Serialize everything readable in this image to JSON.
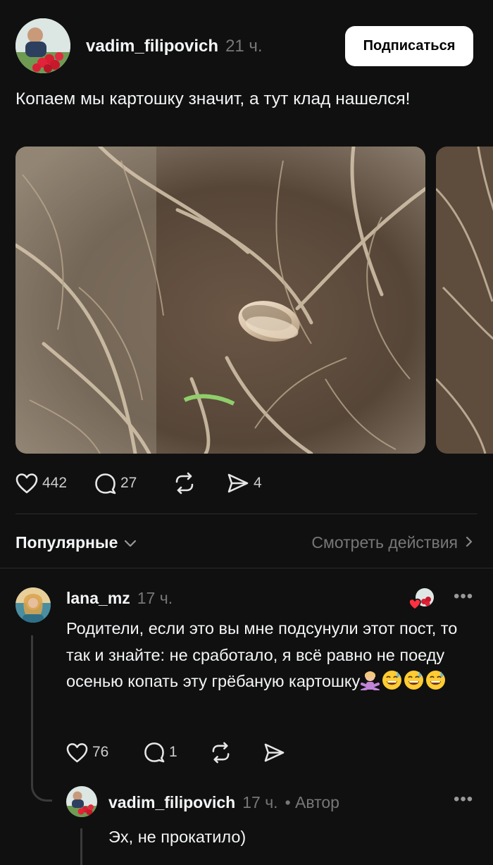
{
  "post": {
    "author": "vadim_filipovich",
    "time": "21 ч.",
    "follow_label": "Подписаться",
    "text": "Копаем мы картошку значит, а тут клад нашелся!",
    "stats": {
      "likes": "442",
      "comments": "27",
      "shares": "4"
    }
  },
  "sort": {
    "label": "Популярные",
    "view_actions": "Смотреть действия"
  },
  "comments": [
    {
      "author": "lana_mz",
      "time": "17 ч.",
      "text": "Родители, если это вы мне подсунули этот пост, то так и знайте: не сработало, я всё равно не поеду осенью копать эту грёбаную картошку",
      "emojis": [
        "person-gesturing-no",
        "grinning-sweat",
        "grinning-sweat",
        "grinning-sweat"
      ],
      "stats": {
        "likes": "76",
        "comments": "1"
      }
    },
    {
      "author": "vadim_filipovich",
      "time": "17 ч.",
      "badge": "• Автор",
      "text": "Эх, не прокатило)"
    }
  ],
  "icons": {
    "like": "heart-icon",
    "comment": "comment-bubble-icon",
    "repost": "repost-icon",
    "share": "send-icon",
    "more": "more-icon",
    "chevron": "chevron-icon"
  },
  "colors": {
    "background": "#101010",
    "text": "#f3f5f7",
    "muted": "#777777",
    "button_bg": "#ffffff",
    "like_red": "#ff3040"
  }
}
